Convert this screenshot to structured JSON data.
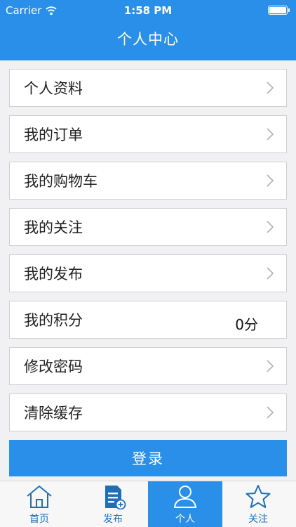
{
  "status_bar": {
    "carrier": "Carrier",
    "time": "1:58 PM"
  },
  "nav": {
    "title": "个人中心"
  },
  "menu": [
    {
      "label": "个人资料",
      "icon": "chevron-right-icon"
    },
    {
      "label": "我的订单",
      "icon": "chevron-right-icon"
    },
    {
      "label": "我的购物车",
      "icon": "chevron-right-icon"
    },
    {
      "label": "我的关注",
      "icon": "chevron-right-icon"
    },
    {
      "label": "我的发布",
      "icon": "chevron-right-icon"
    },
    {
      "label": "我的积分",
      "value": "0分"
    },
    {
      "label": "修改密码",
      "icon": "chevron-right-icon"
    },
    {
      "label": "清除缓存",
      "icon": "chevron-right-icon"
    }
  ],
  "login": {
    "label": "登录"
  },
  "tabbar": {
    "items": [
      {
        "label": "首页",
        "icon": "home-icon"
      },
      {
        "label": "发布",
        "icon": "publish-icon"
      },
      {
        "label": "个人",
        "icon": "person-icon",
        "active": true
      },
      {
        "label": "关注",
        "icon": "star-icon"
      }
    ]
  },
  "colors": {
    "primary": "#2a8fe8",
    "background": "#f1f1f3",
    "tab_text": "#1f6fb8"
  }
}
